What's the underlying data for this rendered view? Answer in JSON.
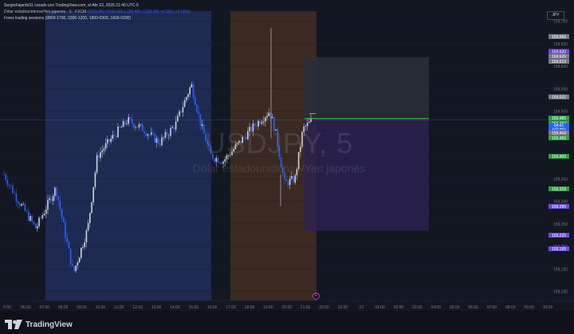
{
  "header": {
    "created_by": "SergioFajardo31 creado con TradingView.com, el Abr 22, 2026 21:40 UTC-5",
    "symbol_line": "Dólar estadounidense/Yen japonés · 5 · FXCM",
    "ohlc": "O159.481 H159.481 L159.481 C159.481 +0.001 (+0.00%)",
    "indicator": "Forex trading sessions (0800-1700, 0300-1200, 1800-0300, 1600-0100)"
  },
  "currency_badge": "JPY",
  "watermark": {
    "ticker": "USDJPY, 5",
    "name": "Dólar estadounidense/Yen japonés"
  },
  "footer_logo": "TradingView",
  "event_marker": "F",
  "colors": {
    "background": "#131722",
    "session_blue": "#1e2a52",
    "session_brown": "#3a2a22",
    "candle_blue": "#2962ff",
    "candle_white": "#d1d4dc",
    "target_zone": "#2a2e39",
    "stop_zone": "#2d2150",
    "green": "#2ea043",
    "purple": "#6f4ad9"
  },
  "chart_data": {
    "type": "candlestick",
    "y_axis": {
      "range": [
        159.08,
        159.74
      ],
      "ticks": [
        "159,700",
        "159,650",
        "159,600",
        "159,550",
        "159,500",
        "159,450",
        "159,400",
        "159,350",
        "159,300",
        "159,250",
        "159,200",
        "159,150",
        "159,100"
      ]
    },
    "x_axis": {
      "ticks": [
        "5:00",
        "06:00",
        "07:00",
        "08:00",
        "09:00",
        "10:00",
        "11:00",
        "12:00",
        "13:00",
        "14:00",
        "15:00",
        "16:00",
        "17:00",
        "18:00",
        "19:00",
        "20:00",
        "21:00",
        "22:00",
        "23:00",
        "23",
        "01:00",
        "02:00",
        "03:00",
        "04:00",
        "05:00",
        "06:00",
        "07:00",
        "08:00",
        "09:00",
        "10:00"
      ]
    },
    "price_labels": [
      {
        "text": "159,666",
        "color": "#787b86"
      },
      {
        "text": "159,633",
        "color": "#6f4ad9"
      },
      {
        "text": "159,626",
        "color": "#787b86"
      },
      {
        "text": "159,613",
        "color": "#787b86"
      },
      {
        "text": "159,532",
        "color": "#787b86"
      },
      {
        "text": "159,485",
        "color": "#2ea043"
      },
      {
        "text": "159,484",
        "color": "#2ea043"
      },
      {
        "text": "159,481",
        "color": "#2962ff"
      },
      {
        "text": "159,454",
        "color": "#787b86"
      },
      {
        "text": "159,450",
        "color": "#2ea043"
      },
      {
        "text": "159,400",
        "color": "#2ea043"
      },
      {
        "text": "159,328",
        "color": "#2ea043"
      },
      {
        "text": "159,289",
        "color": "#6f4ad9"
      },
      {
        "text": "159,225",
        "color": "#6f4ad9"
      },
      {
        "text": "159,195",
        "color": "#6f4ad9"
      }
    ],
    "last_price": "159,481",
    "countdown": "04:41"
  }
}
